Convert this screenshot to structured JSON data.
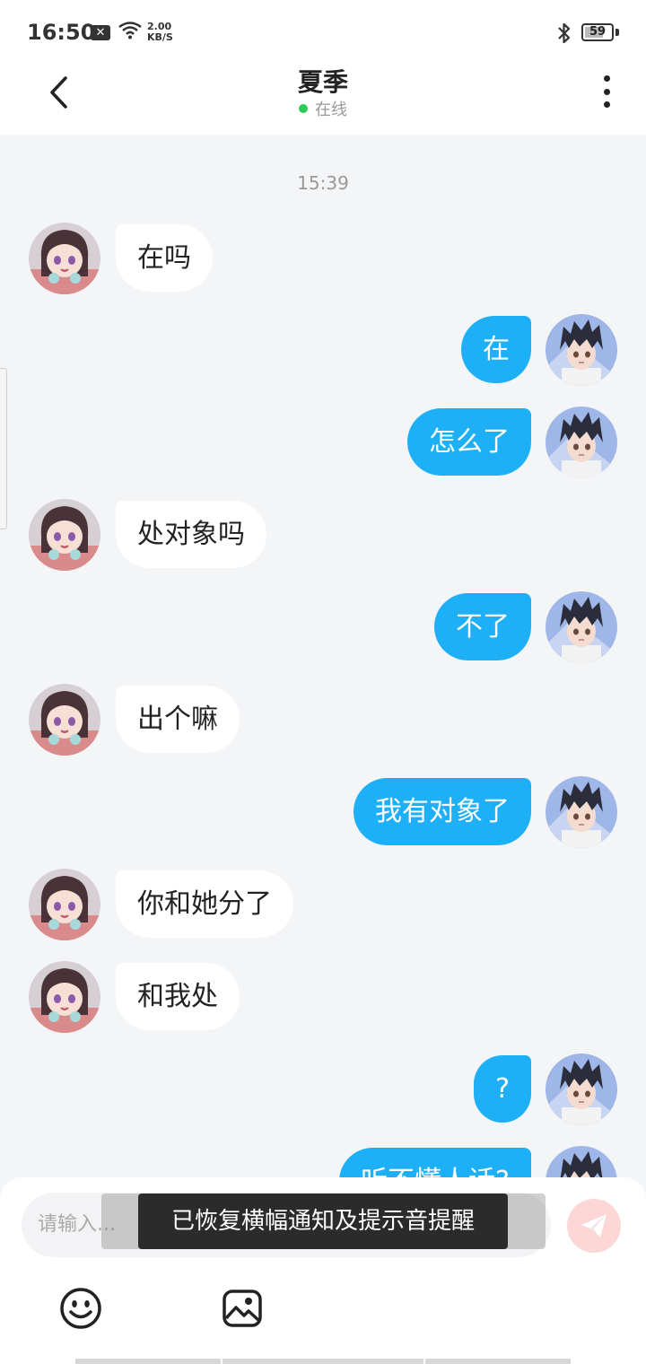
{
  "status_bar": {
    "time": "16:50",
    "notification_icon": "close-box-icon",
    "speed_value": "2.00",
    "speed_unit": "KB/S",
    "battery": "59"
  },
  "header": {
    "title": "夏季",
    "status": "在线",
    "status_color": "#2ecc55"
  },
  "chat": {
    "timestamp": "15:39",
    "messages": [
      {
        "from": "other",
        "text": "在吗"
      },
      {
        "from": "me",
        "text": "在"
      },
      {
        "from": "me",
        "text": "怎么了"
      },
      {
        "from": "other",
        "text": "处对象吗"
      },
      {
        "from": "me",
        "text": "不了"
      },
      {
        "from": "other",
        "text": "出个嘛"
      },
      {
        "from": "me",
        "text": "我有对象了"
      },
      {
        "from": "other",
        "text": "你和她分了"
      },
      {
        "from": "other",
        "text": "和我处"
      },
      {
        "from": "me",
        "text": "?"
      },
      {
        "from": "me",
        "text": "听不懂人话?"
      }
    ],
    "bubble_color_me": "#1eb0f6",
    "bubble_color_other": "#ffffff"
  },
  "input_bar": {
    "placeholder": "请输入...",
    "send_icon": "paper-plane-icon",
    "emoji_icon": "smiley-icon",
    "image_icon": "image-icon"
  },
  "toast": {
    "text": "已恢复横幅通知及提示音提醒"
  }
}
